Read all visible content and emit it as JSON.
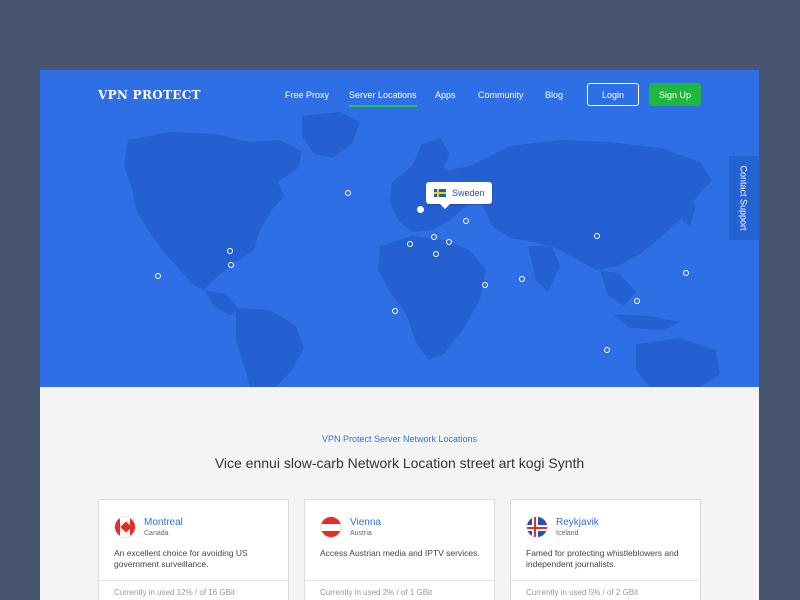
{
  "brand": {
    "logo_text": "VPN PROTECT"
  },
  "nav": {
    "items": [
      {
        "label": "Free Proxy"
      },
      {
        "label": "Server Locations",
        "active": true
      },
      {
        "label": "Apps"
      },
      {
        "label": "Community"
      },
      {
        "label": "Blog"
      }
    ],
    "login_label": "Login",
    "signup_label": "Sign Up"
  },
  "support_tab": {
    "label": "Contact Support"
  },
  "map": {
    "tooltip": {
      "country": "Sweden",
      "flag_icon": "sweden-flag-icon"
    },
    "marker_icon": "location-dot-icon"
  },
  "section": {
    "kicker": "VPN Protect Server Network Locations",
    "title": "Vice ennui slow-carb Network Location street art kogi Synth"
  },
  "cards": [
    {
      "city": "Montreal",
      "country": "Canada",
      "flag_icon": "canada-flag-icon",
      "description": "An excellent choice for avoiding US government surveillance.",
      "usage": "Currently in used 12% / of 16 GBit"
    },
    {
      "city": "Vienna",
      "country": "Austria",
      "flag_icon": "austria-flag-icon",
      "description": "Access Austrian media and IPTV services.",
      "usage": "Currently in used 2% / of 1 GBit"
    },
    {
      "city": "Reykjavik",
      "country": "Iceland",
      "flag_icon": "iceland-flag-icon",
      "description": "Famed for protecting whistleblowers and independent journalists.",
      "usage": "Currently in used 5% / of 2 GBit"
    }
  ],
  "colors": {
    "background": "#475571",
    "hero_blue": "#2f6fe6",
    "land_blue": "#2563d4",
    "accent_green": "#1fb83f",
    "link_blue": "#2f6fe6"
  }
}
